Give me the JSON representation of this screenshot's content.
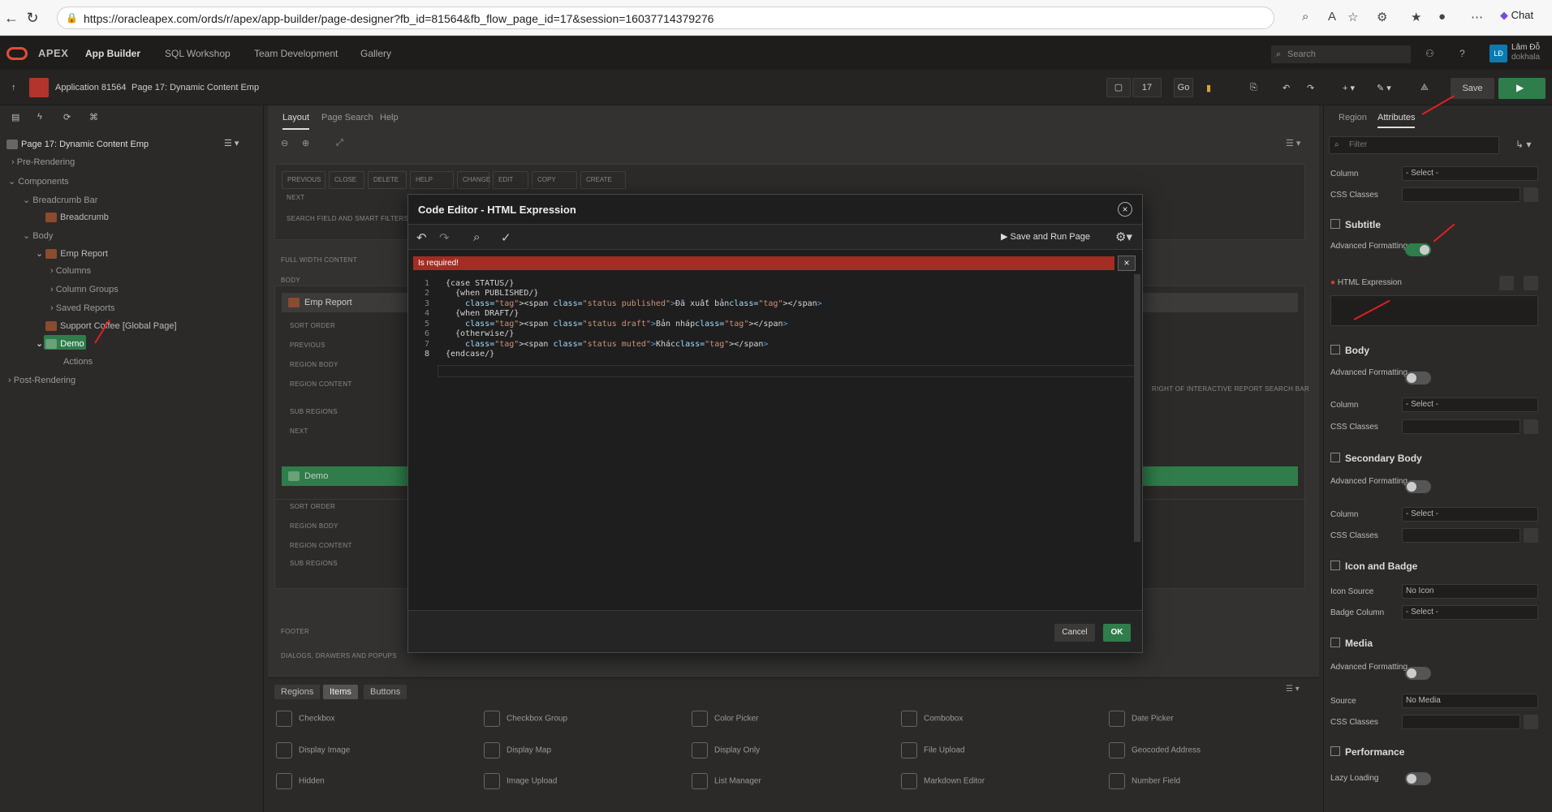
{
  "browser": {
    "url": "https://oracleapex.com/ords/r/apex/app-builder/page-designer?fb_id=81564&fb_flow_page_id=17&session=16037714379276",
    "chat_label": "Chat"
  },
  "apex_nav": {
    "brand": "APEX",
    "menus": [
      "App Builder",
      "SQL Workshop",
      "Team Development",
      "Gallery"
    ],
    "search_placeholder": "Search",
    "user_initials": "LĐ",
    "user_name": "Lâm Đỗ",
    "user_id": "dokhala"
  },
  "toolbar": {
    "app_label": "Application 81564",
    "page_label": "Page 17: Dynamic Content Emp",
    "page_number": "17",
    "go_label": "Go",
    "save_label": "Save"
  },
  "tree": {
    "root": "Page 17: Dynamic Content Emp",
    "items": [
      {
        "label": "Pre-Rendering"
      },
      {
        "label": "Components"
      },
      {
        "label": "Breadcrumb Bar"
      },
      {
        "label": "Breadcrumb"
      },
      {
        "label": "Body"
      },
      {
        "label": "Emp Report"
      },
      {
        "label": "Columns"
      },
      {
        "label": "Column Groups"
      },
      {
        "label": "Saved Reports"
      },
      {
        "label": "Support Coffee [Global Page]"
      },
      {
        "label": "Demo"
      },
      {
        "label": "Actions"
      },
      {
        "label": "Post-Rendering"
      }
    ]
  },
  "center": {
    "tabs": [
      "Layout",
      "Page Search",
      "Help"
    ],
    "top_buttons": [
      "PREVIOUS",
      "CLOSE",
      "DELETE",
      "HELP",
      "CHANGE",
      "EDIT",
      "COPY",
      "CREATE"
    ],
    "next_label": "NEXT",
    "search_field_label": "SEARCH FIELD AND SMART FILTERS",
    "full_width_label": "FULL WIDTH CONTENT",
    "body_label": "BODY",
    "emp_report_title": "Emp Report",
    "emp_slots": [
      "SORT ORDER",
      "PREVIOUS",
      "REGION BODY",
      "REGION CONTENT",
      "SUB REGIONS",
      "NEXT"
    ],
    "right_ir_label": "RIGHT OF INTERACTIVE REPORT SEARCH BAR",
    "demo_title": "Demo",
    "demo_slots": [
      "SORT ORDER",
      "REGION BODY",
      "REGION CONTENT",
      "SUB REGIONS"
    ],
    "footer_label": "FOOTER",
    "dialogs_label": "DIALOGS, DRAWERS AND POPUPS"
  },
  "gallery": {
    "tabs": [
      "Regions",
      "Items",
      "Buttons"
    ],
    "items": [
      "Checkbox",
      "Checkbox Group",
      "Color Picker",
      "Combobox",
      "Date Picker",
      "Display Image",
      "Display Map",
      "Display Only",
      "File Upload",
      "Geocoded Address",
      "Hidden",
      "Image Upload",
      "List Manager",
      "Markdown Editor",
      "Number Field"
    ]
  },
  "right": {
    "tabs": [
      "Region",
      "Attributes"
    ],
    "filter_placeholder": "Filter",
    "column_label": "Column",
    "select_placeholder": "- Select -",
    "css_classes_label": "CSS Classes",
    "subtitle_group": "Subtitle",
    "advanced_formatting_label": "Advanced Formatting",
    "html_expression_label": "HTML Expression",
    "body_group": "Body",
    "secondary_body_group": "Secondary Body",
    "icon_badge_group": "Icon and Badge",
    "icon_source_label": "Icon Source",
    "icon_source_value": "No Icon",
    "badge_column_label": "Badge Column",
    "media_group": "Media",
    "source_label": "Source",
    "source_value": "No Media",
    "performance_group": "Performance",
    "lazy_loading_label": "Lazy Loading"
  },
  "dialog": {
    "title": "Code Editor - HTML Expression",
    "save_run_label": "Save and Run Page",
    "error_text": "Is required!",
    "cancel_label": "Cancel",
    "ok_label": "OK",
    "code_lines": [
      "{case STATUS/}",
      "  {when PUBLISHED/}",
      "    <span class=\"status published\">Đã xuất bản</span>",
      "  {when DRAFT/}",
      "    <span class=\"status draft\">Bản nháp</span>",
      "  {otherwise/}",
      "    <span class=\"status muted\">Khác</span>",
      "{endcase/}"
    ]
  },
  "colors": {
    "accent_green": "#2f7d4a",
    "error_red": "#a32d22",
    "apex_red": "#e34c38"
  }
}
